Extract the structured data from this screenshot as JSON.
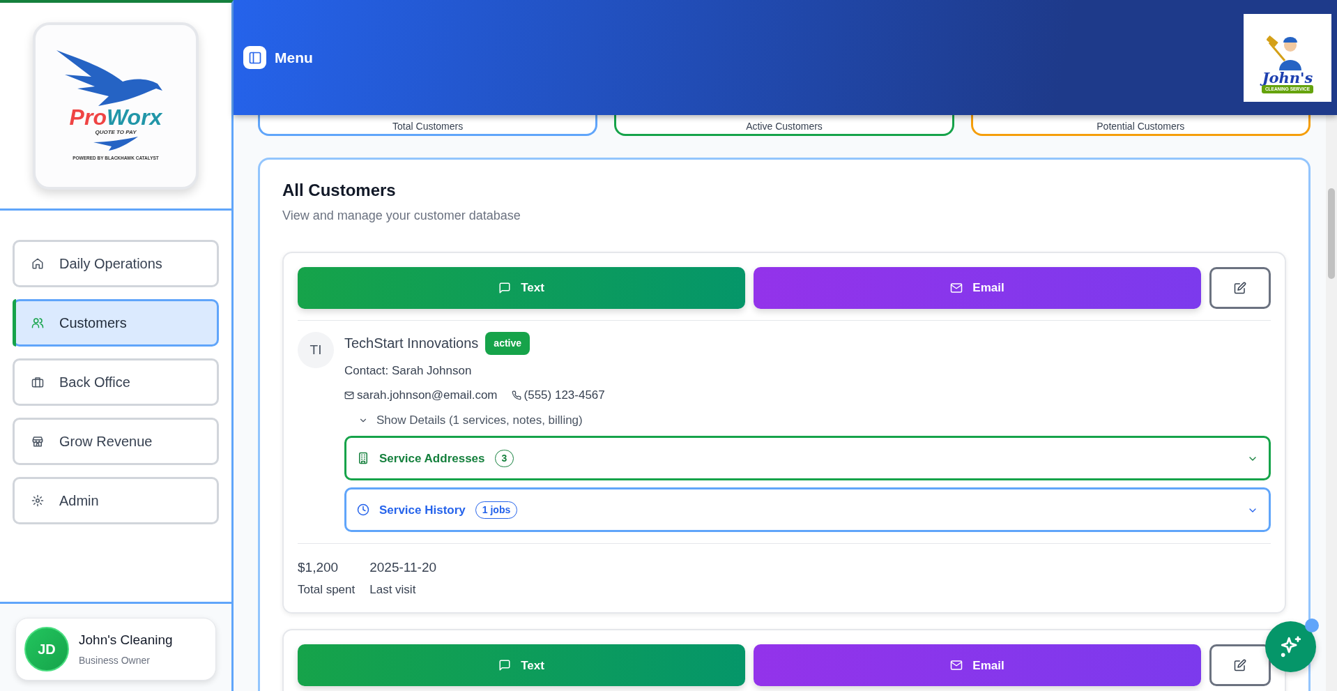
{
  "sidebar": {
    "logo": {
      "brand_left": "Pro",
      "brand_right": "Worx",
      "tagline": "QUOTE TO PAY",
      "powered_by": "POWERED BY BLACKHAWK CATALYST"
    },
    "items": [
      {
        "label": "Daily Operations",
        "selected": false
      },
      {
        "label": "Customers",
        "selected": true
      },
      {
        "label": "Back Office",
        "selected": false
      },
      {
        "label": "Grow Revenue",
        "selected": false
      },
      {
        "label": "Admin",
        "selected": false
      }
    ],
    "user": {
      "initials": "JD",
      "name": "John's Cleaning",
      "role": "Business Owner"
    }
  },
  "header": {
    "menu_label": "Menu",
    "business_logo": {
      "name": "John's",
      "subtitle": "CLEANING SERVICE"
    }
  },
  "stats": [
    {
      "label": "Total Customers",
      "color": "#60a5fa"
    },
    {
      "label": "Active Customers",
      "color": "#16a34a"
    },
    {
      "label": "Potential Customers",
      "color": "#f59e0b"
    }
  ],
  "panel": {
    "title": "All Customers",
    "subtitle": "View and manage your customer database"
  },
  "customers": [
    {
      "actions": [
        "Text",
        "Email"
      ],
      "initials": "TI",
      "name": "TechStart Innovations",
      "status": "active",
      "contact": "Contact: Sarah Johnson",
      "email": "sarah.johnson@email.com",
      "phone": "(555) 123-4567",
      "details_toggle": "Show Details (1 services, notes, billing)",
      "expanded": false,
      "sections": [
        {
          "kind": "addresses",
          "label": "Service Addresses",
          "count": "3"
        },
        {
          "kind": "history",
          "label": "Service History",
          "count": "1 jobs"
        }
      ],
      "total_spent": "$1,200",
      "total_spent_label": "Total spent",
      "last_visit": "2025-11-20",
      "last_visit_label": "Last visit"
    },
    {
      "actions": [
        "Text",
        "Email"
      ]
    }
  ]
}
